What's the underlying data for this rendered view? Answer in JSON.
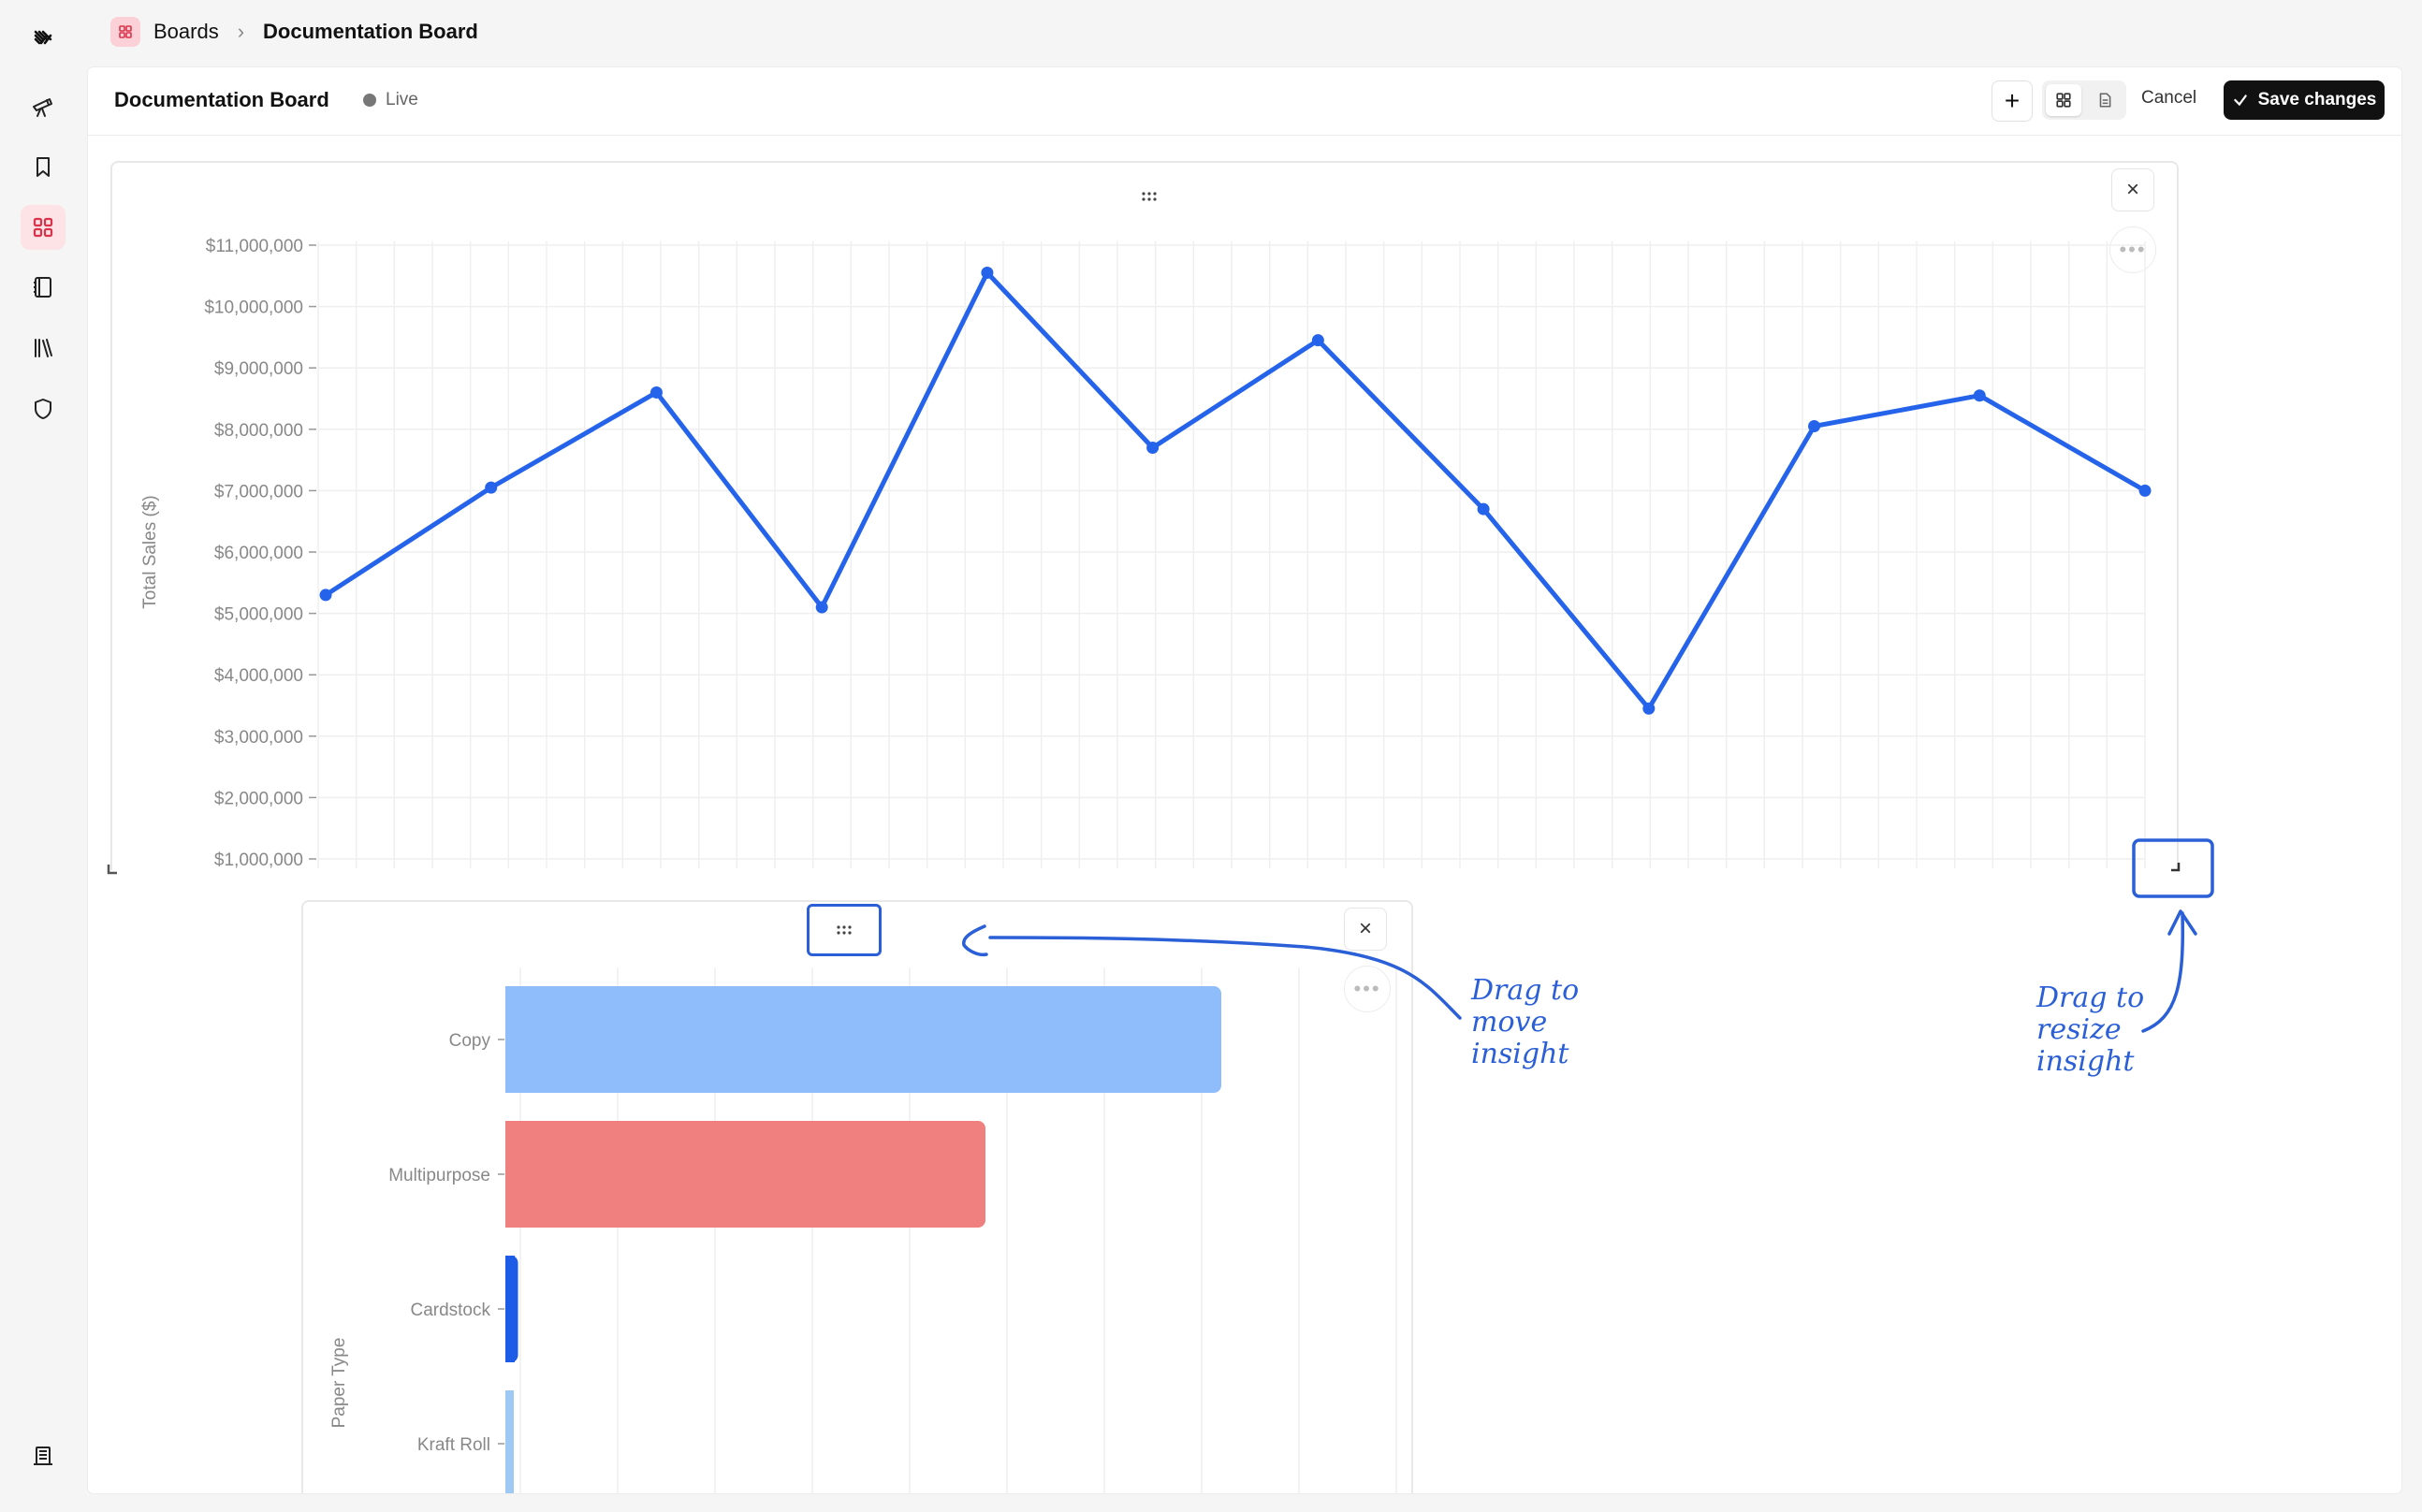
{
  "breadcrumb": {
    "root": "Boards",
    "current": "Documentation Board"
  },
  "toolbar": {
    "title": "Documentation Board",
    "status": "Live",
    "add_label": "+",
    "cancel_label": "Cancel",
    "save_label": "Save changes"
  },
  "sidebar": {
    "items": [
      {
        "icon": "logo-icon"
      },
      {
        "icon": "telescope-icon"
      },
      {
        "icon": "bookmark-icon"
      },
      {
        "icon": "grid-icon",
        "active": true
      },
      {
        "icon": "notebook-icon"
      },
      {
        "icon": "library-icon"
      },
      {
        "icon": "shield-icon"
      },
      {
        "icon": "building-icon"
      }
    ]
  },
  "colors": {
    "accent": "#2563eb",
    "active_bg": "#fde2e6",
    "save_bg": "#111111"
  },
  "annotations": {
    "move": "Drag to\nmove\ninsight",
    "resize": "Drag to\nresize\ninsight"
  },
  "chart_data": [
    {
      "type": "line",
      "ylabel": "Total Sales ($)",
      "ylim": [
        1000000,
        11000000
      ],
      "yticks": [
        "$1,000,000",
        "$2,000,000",
        "$3,000,000",
        "$4,000,000",
        "$5,000,000",
        "$6,000,000",
        "$7,000,000",
        "$8,000,000",
        "$9,000,000",
        "$10,000,000",
        "$11,000,000"
      ],
      "color": "#2563eb",
      "series": [
        {
          "values": [
            5300000,
            7050000,
            8600000,
            5100000,
            10550000,
            7700000,
            9450000,
            6700000,
            3450000,
            8050000,
            8550000,
            7000000
          ]
        }
      ],
      "grid": true
    },
    {
      "type": "bar",
      "orientation": "horizontal",
      "ylabel": "Paper Type",
      "categories": [
        "Copy",
        "Multipurpose",
        "Cardstock",
        "Kraft Roll"
      ],
      "values": [
        85,
        57,
        1.5,
        1
      ],
      "colors": [
        "#8fbcfb",
        "#f07f7f",
        "#1d5ce6",
        "#9ec9f5"
      ],
      "grid": true
    }
  ]
}
